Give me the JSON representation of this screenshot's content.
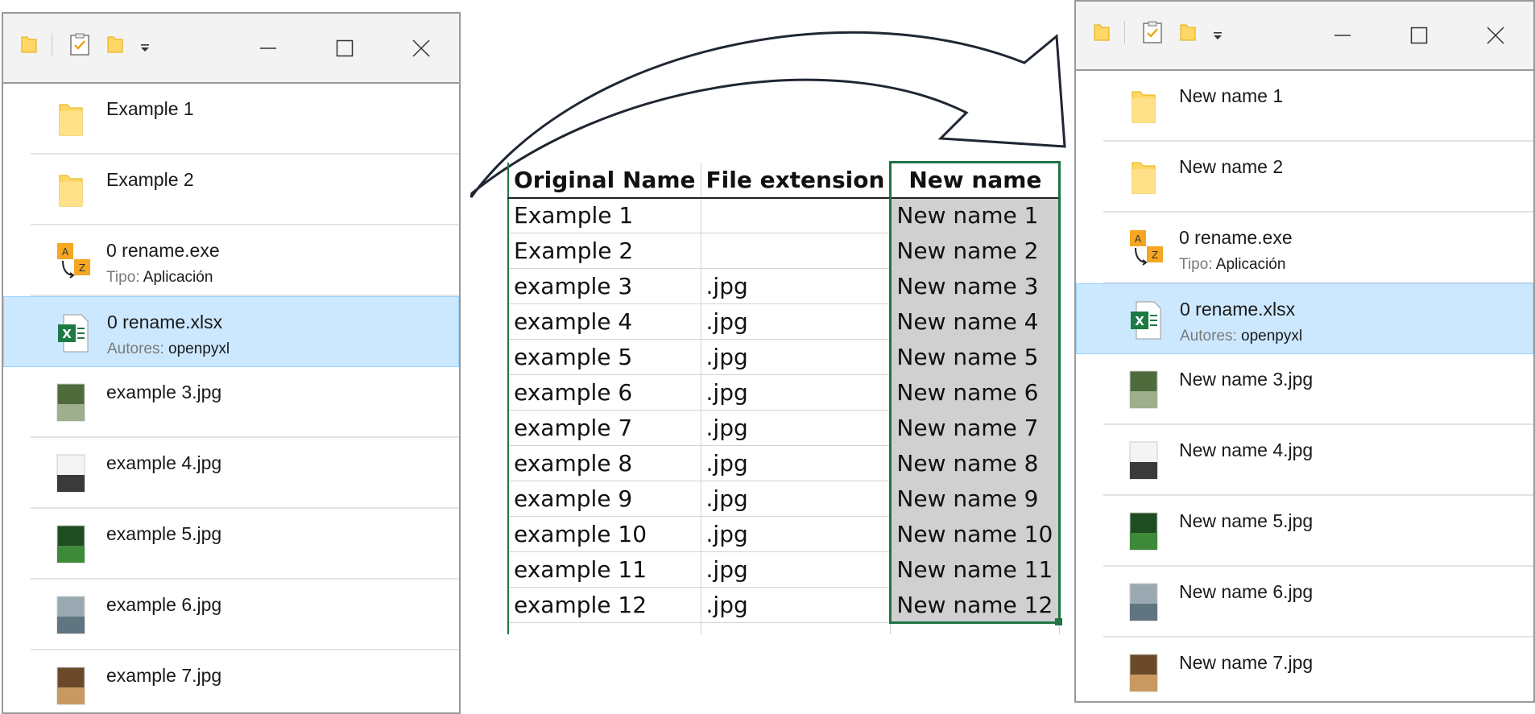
{
  "left_window": {
    "files": [
      {
        "name": "Example 1",
        "kind": "folder"
      },
      {
        "name": "Example 2",
        "kind": "folder"
      },
      {
        "name": "0 rename.exe",
        "kind": "exe",
        "meta_key": "Tipo:",
        "meta_val": "Aplicación"
      },
      {
        "name": "0 rename.xlsx",
        "kind": "xlsx",
        "meta_key": "Autores:",
        "meta_val": "openpyxl",
        "selected": true
      },
      {
        "name": "example 3.jpg",
        "kind": "img"
      },
      {
        "name": "example 4.jpg",
        "kind": "img"
      },
      {
        "name": "example 5.jpg",
        "kind": "img"
      },
      {
        "name": "example 6.jpg",
        "kind": "img"
      },
      {
        "name": "example 7.jpg",
        "kind": "img"
      }
    ]
  },
  "right_window": {
    "files": [
      {
        "name": "New name 1",
        "kind": "folder"
      },
      {
        "name": "New name 2",
        "kind": "folder"
      },
      {
        "name": "0 rename.exe",
        "kind": "exe",
        "meta_key": "Tipo:",
        "meta_val": "Aplicación"
      },
      {
        "name": "0 rename.xlsx",
        "kind": "xlsx",
        "meta_key": "Autores:",
        "meta_val": "openpyxl",
        "selected": true
      },
      {
        "name": "New name 3.jpg",
        "kind": "img"
      },
      {
        "name": "New name 4.jpg",
        "kind": "img"
      },
      {
        "name": "New name 5.jpg",
        "kind": "img"
      },
      {
        "name": "New name 6.jpg",
        "kind": "img"
      },
      {
        "name": "New name 7.jpg",
        "kind": "img"
      }
    ]
  },
  "spreadsheet": {
    "headers": [
      "Original Name",
      "File extension",
      "New name"
    ],
    "rows": [
      [
        "Example 1",
        "",
        "New name 1"
      ],
      [
        "Example 2",
        "",
        "New name 2"
      ],
      [
        "example 3",
        ".jpg",
        "New name 3"
      ],
      [
        "example 4",
        ".jpg",
        "New name 4"
      ],
      [
        "example 5",
        ".jpg",
        "New name 5"
      ],
      [
        "example 6",
        ".jpg",
        "New name 6"
      ],
      [
        "example 7",
        ".jpg",
        "New name 7"
      ],
      [
        "example 8",
        ".jpg",
        "New name 8"
      ],
      [
        "example 9",
        ".jpg",
        "New name 9"
      ],
      [
        "example 10",
        ".jpg",
        "New name 10"
      ],
      [
        "example 11",
        ".jpg",
        "New name 11"
      ],
      [
        "example 12",
        ".jpg",
        "New name 12"
      ]
    ]
  },
  "colors": {
    "selection_bg": "#cce8ff",
    "excel_green": "#217346",
    "folder_yellow": "#ffd766",
    "cell_highlight": "#d0d0d0"
  },
  "icons": [
    "folder-icon",
    "properties-icon",
    "customize-toolbar-icon",
    "minimize-icon",
    "maximize-icon",
    "close-icon",
    "exe-rename-icon",
    "excel-file-icon",
    "image-thumbnail",
    "curved-arrow"
  ]
}
